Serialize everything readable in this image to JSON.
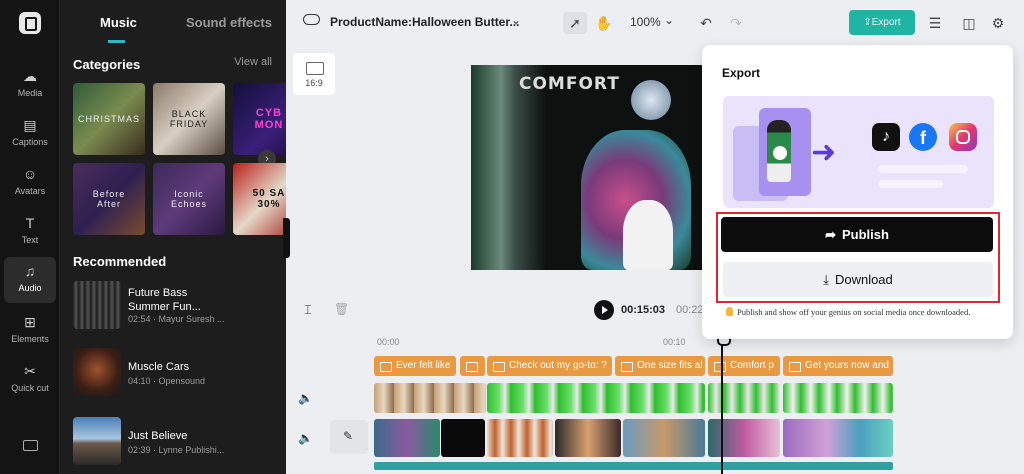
{
  "rail": {
    "items": [
      {
        "label": "Media",
        "icon": "cloud-upload-icon"
      },
      {
        "label": "Captions",
        "icon": "captions-icon"
      },
      {
        "label": "Avatars",
        "icon": "avatar-icon"
      },
      {
        "label": "Text",
        "icon": "text-icon"
      },
      {
        "label": "Audio",
        "icon": "music-note-icon"
      },
      {
        "label": "Elements",
        "icon": "elements-icon"
      },
      {
        "label": "Quick cut",
        "icon": "quick-cut-icon"
      }
    ]
  },
  "panel": {
    "tabs": [
      "Music",
      "Sound effects"
    ],
    "categories_title": "Categories",
    "view_all": "View all",
    "categories": [
      "CHRISTMAS",
      "BLACK FRIDAY",
      "CYB MON",
      "Before After",
      "Iconic Echoes",
      "50 SA 30%"
    ],
    "recommended_title": "Recommended",
    "tracks": [
      {
        "name": "Future Bass Summer Fun...",
        "meta": "02:54 · Mayur Suresh ..."
      },
      {
        "name": "Muscle Cars",
        "meta": "04:10 · Opensound"
      },
      {
        "name": "Just Believe",
        "meta": "02:39 · Lynne Publishi..."
      }
    ]
  },
  "header": {
    "title": "ProductName:Halloween Butter...",
    "zoom": "100%",
    "export_label": "Export"
  },
  "canvas": {
    "ratio": "16:9",
    "preview_text": "COMFORT"
  },
  "timeline": {
    "current_time": "00:15:03",
    "total_time_partial": "00:22",
    "ruler": [
      "00:00",
      "00:10"
    ],
    "captions": [
      "Ever felt like",
      "",
      "Check out my go-to: ?",
      "One size fits al",
      "Comfort p",
      "Get yours now and"
    ]
  },
  "export_modal": {
    "title": "Export",
    "publish_label": "Publish",
    "download_label": "Download",
    "hint": "Publish and show off your genius on social media once downloaded.",
    "accent_color": "#20b5a2",
    "highlight_color": "#e0262e"
  }
}
